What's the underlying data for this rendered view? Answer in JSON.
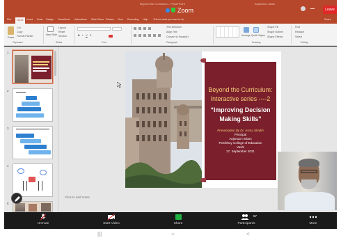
{
  "window": {
    "title_faint": "Beyond the Curriculum - PowerPoint",
    "title_right": "Anjuman-I-Islam",
    "zoom_label": "Zoom",
    "leave_label": "Leave"
  },
  "menu": {
    "tabs": [
      "File",
      "Home",
      "Insert",
      "Draw",
      "Design",
      "Transitions",
      "Animations",
      "Slide Show",
      "Review",
      "View",
      "Recording",
      "Help",
      "Tell me what you want to do"
    ],
    "active_tab": "Home",
    "share_label": "Share"
  },
  "ribbon": {
    "groups": [
      "Clipboard",
      "Slides",
      "Font",
      "Paragraph",
      "Drawing",
      "Editing"
    ],
    "clipboard": {
      "paste": "Paste",
      "cut": "Cut",
      "copy": "Copy",
      "format_painter": "Format Painter"
    },
    "slides": {
      "new_slide": "New Slide",
      "layout": "Layout",
      "reset": "Reset",
      "section": "Section"
    },
    "paragraph": {
      "text_direction": "Text Direction",
      "align_text": "Align Text",
      "smartart": "Convert to SmartArt"
    },
    "drawing": {
      "arrange": "Arrange",
      "quick_styles": "Quick Styles",
      "shape_fill": "Shape Fill",
      "shape_outline": "Shape Outline",
      "shape_effects": "Shape Effects"
    },
    "editing": {
      "find": "Find",
      "replace": "Replace",
      "select": "Select"
    }
  },
  "thumbnails": {
    "numbers": [
      "1",
      "2",
      "3",
      "4",
      "5"
    ]
  },
  "slide": {
    "line1": "Beyond the Curriculum:",
    "line2": "Interactive series ----2",
    "line3": "“Improving Decision",
    "line4": "Making Skills”",
    "presenter": "Presentation By Dr. Asma Shaikh",
    "role": "Principal",
    "org1": "Anjuman I Islam",
    "org2": "Peerbhoy College of Education",
    "org3": "Vashi",
    "date": "27, September 2021"
  },
  "notes": {
    "placeholder": "Click to add notes"
  },
  "toolbar": {
    "unmute": "Unmute",
    "start_video": "Start Video",
    "share": "Share",
    "participants": "Participants",
    "participants_count": "57",
    "more": "More"
  },
  "android_nav": {
    "recent": "|||",
    "home": "○",
    "back": "<"
  },
  "colors": {
    "ppt_accent": "#b7472a",
    "slide_panel": "#7a1f2b",
    "slide_gold": "#f6d07a",
    "leave_red": "#e02828",
    "share_green": "#1fb141"
  }
}
